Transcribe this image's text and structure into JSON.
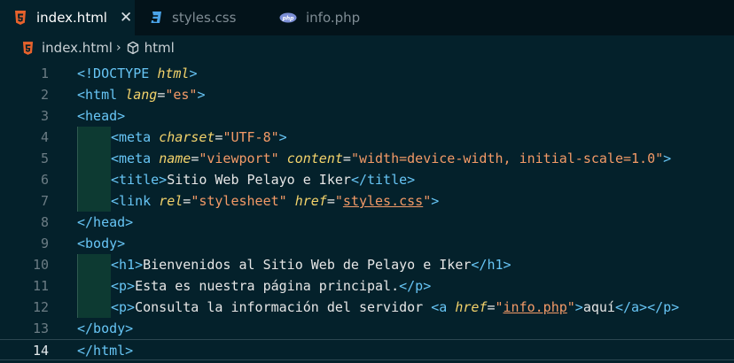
{
  "tabs": [
    {
      "label": "index.html",
      "icon": "html5-icon",
      "active": true,
      "close": "✕"
    },
    {
      "label": "styles.css",
      "icon": "css3-icon",
      "active": false
    },
    {
      "label": "info.php",
      "icon": "php-icon",
      "active": false,
      "icon_text": "php"
    }
  ],
  "breadcrumb": {
    "file": "index.html",
    "separator": "›",
    "symbol": "html"
  },
  "colors": {
    "tag": "#67c5f5",
    "attribute": "#f3d36b",
    "string": "#f39a67",
    "text": "#e6e6e6",
    "html_icon": "#e8622c",
    "css_icon": "#4aa3e8",
    "php_icon": "#7c8fd6"
  },
  "editor": {
    "current_line": "14",
    "lines": [
      {
        "n": "1",
        "p": [
          "<!DOCTYPE",
          " ",
          "html",
          ">"
        ]
      },
      {
        "n": "2",
        "p": [
          "<html",
          " ",
          "lang",
          "=",
          "\"es\"",
          ">"
        ]
      },
      {
        "n": "3",
        "p": [
          "<head>"
        ]
      },
      {
        "n": "4",
        "p": [
          "<meta",
          " ",
          "charset",
          "=",
          "\"UTF-8\"",
          ">"
        ]
      },
      {
        "n": "5",
        "p": [
          "<meta",
          " ",
          "name",
          "=",
          "\"viewport\"",
          " ",
          "content",
          "=",
          "\"width=device-width, initial-scale=1.0\"",
          ">"
        ]
      },
      {
        "n": "6",
        "p": [
          "<title>",
          "Sitio Web Pelayo e Iker",
          "</title>"
        ]
      },
      {
        "n": "7",
        "p": [
          "<link",
          " ",
          "rel",
          "=",
          "\"stylesheet\"",
          " ",
          "href",
          "=",
          "\"",
          "styles.css",
          "\"",
          ">"
        ]
      },
      {
        "n": "8",
        "p": [
          "</head>"
        ]
      },
      {
        "n": "9",
        "p": [
          "<body>"
        ]
      },
      {
        "n": "10",
        "p": [
          "<h1>",
          "Bienvenidos al Sitio Web de Pelayo e Iker",
          "</h1>"
        ]
      },
      {
        "n": "11",
        "p": [
          "<p>",
          "Esta es nuestra página principal.",
          "</p>"
        ]
      },
      {
        "n": "12",
        "p": [
          "<p>",
          "Consulta la información del servidor ",
          "<a",
          " ",
          "href",
          "=",
          "\"",
          "info.php",
          "\"",
          ">",
          "aquí",
          "</a>",
          "</p>"
        ]
      },
      {
        "n": "13",
        "p": [
          "</body>"
        ]
      },
      {
        "n": "14",
        "p": [
          "</html>"
        ]
      }
    ]
  }
}
